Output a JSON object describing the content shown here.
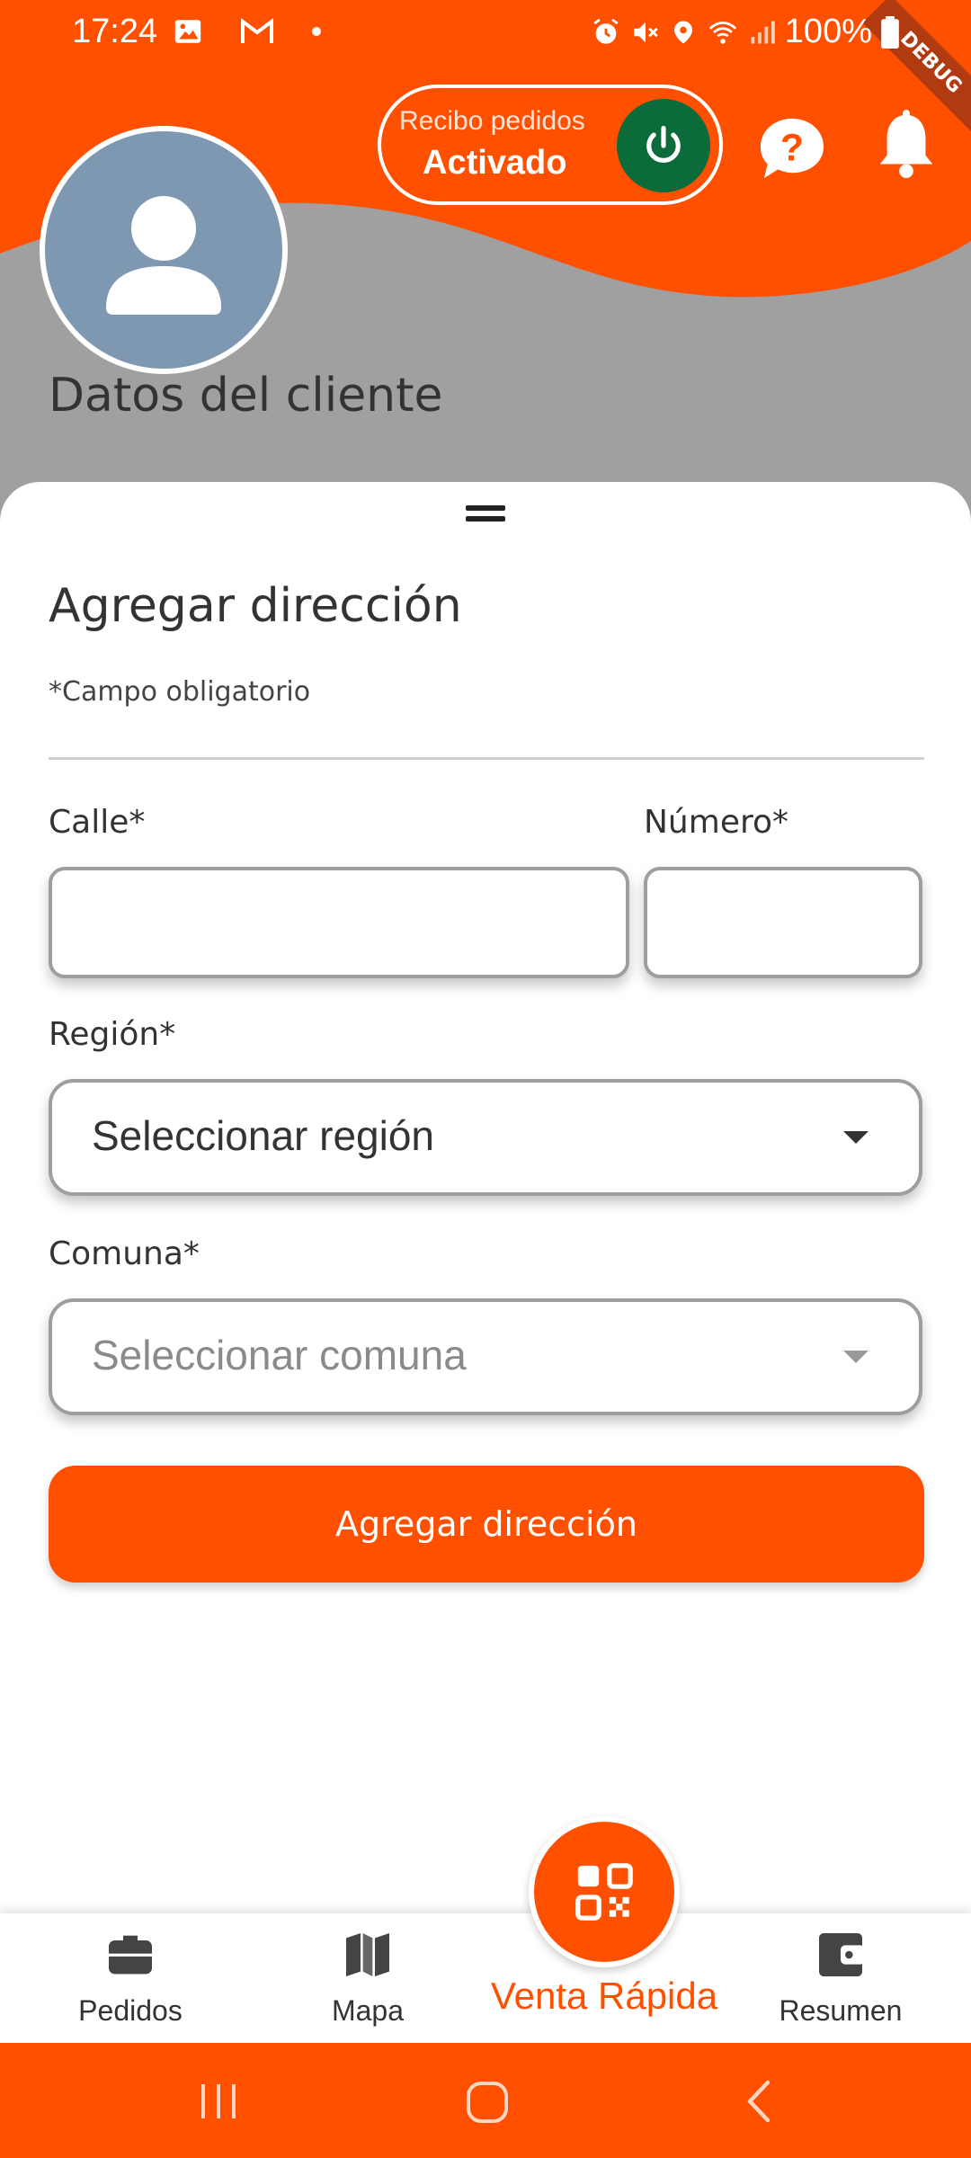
{
  "status_bar": {
    "time": "17:24",
    "battery": "100%",
    "icons_left": [
      "image-icon",
      "gmail-icon",
      "dot-icon"
    ],
    "icons_right": [
      "alarm-icon",
      "mute-icon",
      "location-icon",
      "wifi-icon",
      "signal-icon",
      "battery-icon"
    ]
  },
  "header": {
    "receive_orders_label": "Recibo pedidos",
    "receive_orders_value": "Activado",
    "client_section_title": "Datos del cliente",
    "debug_ribbon": "DEBUG"
  },
  "form": {
    "title": "Agregar dirección",
    "required_note": "*Campo obligatorio",
    "street_label": "Calle*",
    "street_value": "",
    "number_label": "Número*",
    "number_value": "",
    "region_label": "Región*",
    "region_selected": "Seleccionar región",
    "commune_label": "Comuna*",
    "commune_selected": "Seleccionar comuna",
    "submit_label": "Agregar dirección"
  },
  "bottom_nav": {
    "items": [
      {
        "label": "Pedidos",
        "icon": "briefcase-icon"
      },
      {
        "label": "Mapa",
        "icon": "map-icon"
      },
      {
        "label": "Venta Rápida",
        "icon": "qr-code-icon"
      },
      {
        "label": "Resumen",
        "icon": "wallet-icon"
      }
    ]
  },
  "colors": {
    "brand_orange": "#ff5000",
    "toggle_active_green": "#0b6b3a",
    "header_gray": "#a0a0a0",
    "avatar_bg": "#7f98b2"
  }
}
